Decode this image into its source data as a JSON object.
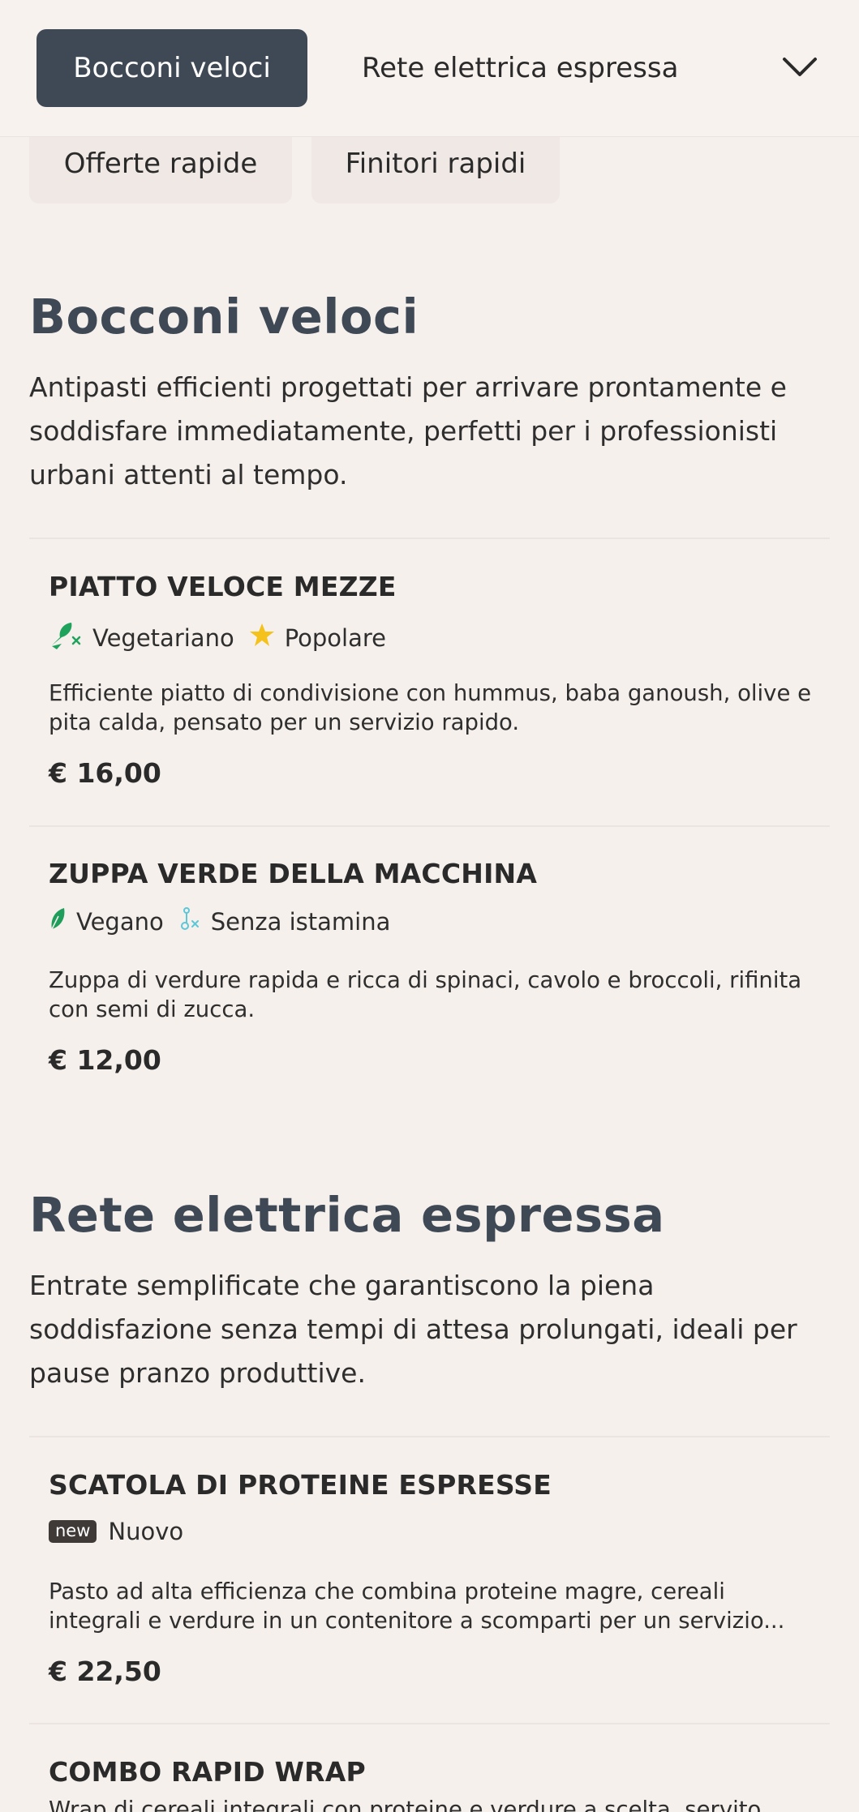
{
  "nav": {
    "active_tab": "Bocconi veloci",
    "next_tab": "Rete elettrica espressa",
    "chips": [
      "Offerte rapide",
      "Finitori rapidi"
    ]
  },
  "sections": [
    {
      "title": "Bocconi veloci",
      "description": "Antipasti efficienti progettati per arrivare prontamente e soddisfare immediatamente, perfetti per i professionisti urbani attenti al tempo.",
      "items": [
        {
          "name": "PIATTO VELOCE MEZZE",
          "tags": [
            {
              "label": "Vegetariano",
              "icon": "vegetarian-icon"
            },
            {
              "label": "Popolare",
              "icon": "star-icon"
            }
          ],
          "description": "Efficiente piatto di condivisione con hummus, baba ganoush, olive e pita calda, pensato per un servizio rapido.",
          "price": "€ 16,00"
        },
        {
          "name": "ZUPPA VERDE DELLA MACCHINA",
          "tags": [
            {
              "label": "Vegano",
              "icon": "leaf-icon"
            },
            {
              "label": "Senza istamina",
              "icon": "histamine-free-icon"
            }
          ],
          "description": "Zuppa di verdure rapida e ricca di spinaci, cavolo e broccoli, rifinita con semi di zucca.",
          "price": "€ 12,00"
        }
      ]
    },
    {
      "title": "Rete elettrica espressa",
      "description": "Entrate semplificate che garantiscono la piena soddisfazione senza tempi di attesa prolungati, ideali per pause pranzo produttive.",
      "items": [
        {
          "name": "SCATOLA DI PROTEINE ESPRESSE",
          "badge": "new",
          "tags": [
            {
              "label": "Nuovo",
              "icon": "new-badge"
            }
          ],
          "description": "Pasto ad alta efficienza che combina proteine magre, cereali integrali e verdure in un contenitore a scomparti per un servizio...",
          "price": "€ 22,50"
        },
        {
          "name": "COMBO RAPID WRAP",
          "description": "Wrap di cereali integrali con proteine e verdure a scelta, servito..."
        }
      ]
    }
  ],
  "colors": {
    "background": "#f6f0ec",
    "active_tab": "#3f4955",
    "section_title": "#3f4955",
    "vegetarian": "#1fa35c",
    "star": "#f4c21b",
    "vegan": "#1e9e5a",
    "histamine": "#5bc7d8"
  }
}
